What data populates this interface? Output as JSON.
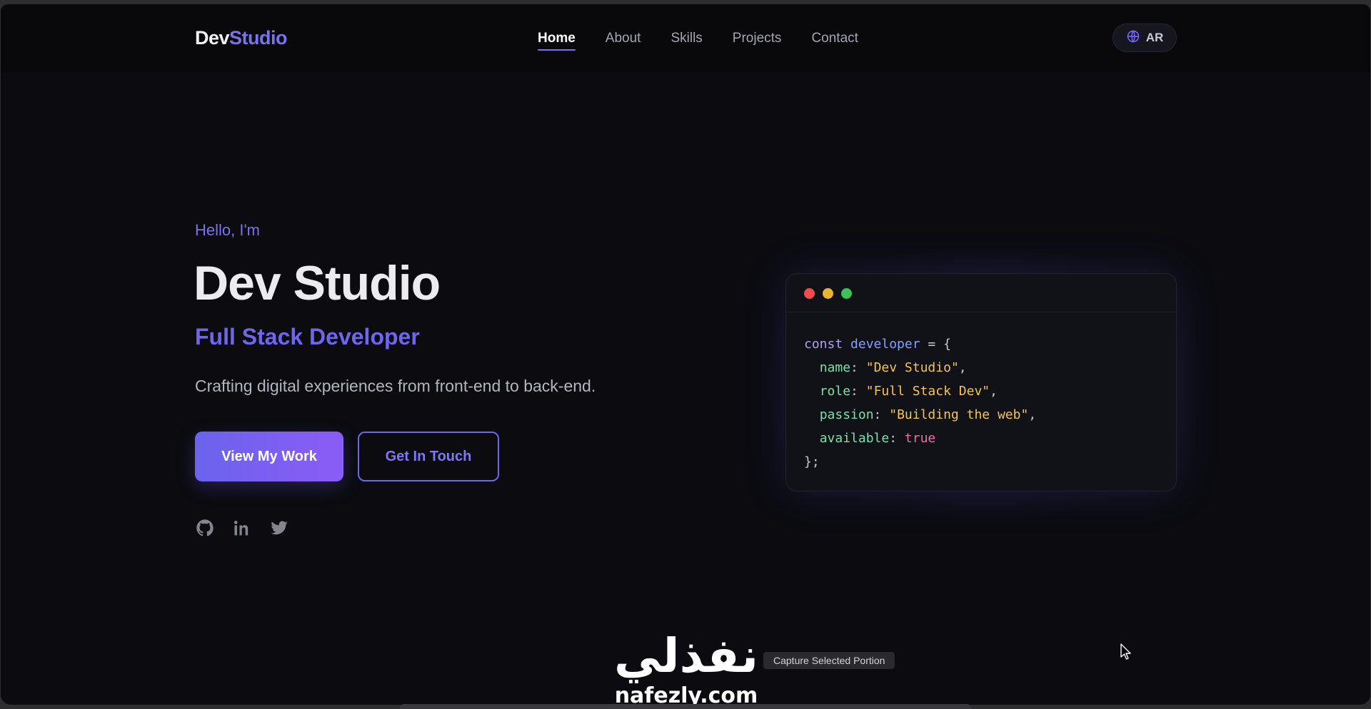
{
  "header": {
    "logo_part1": "Dev",
    "logo_part2": "Studio",
    "nav": [
      {
        "label": "Home",
        "active": true
      },
      {
        "label": "About"
      },
      {
        "label": "Skills"
      },
      {
        "label": "Projects"
      },
      {
        "label": "Contact"
      }
    ],
    "language_button": {
      "label": "AR",
      "icon": "globe-icon"
    }
  },
  "hero": {
    "greeting": "Hello, I'm",
    "name": "Dev Studio",
    "role": "Full Stack Developer",
    "tagline": "Crafting digital experiences from front-end to back-end.",
    "primary_button": "View My Work",
    "secondary_button": "Get In Touch",
    "social_icons": [
      "github-icon",
      "linkedin-icon",
      "twitter-icon"
    ]
  },
  "code_card": {
    "window_dots": [
      "red",
      "yellow",
      "green"
    ],
    "line1": {
      "keyword": "const",
      "var": "developer",
      "rest": " = {"
    },
    "line2": {
      "prop": "name",
      "value": "\"Dev Studio\""
    },
    "line3": {
      "prop": "role",
      "value": "\"Full Stack Dev\""
    },
    "line4": {
      "prop": "passion",
      "value": "\"Building the web\""
    },
    "line5": {
      "prop": "available",
      "value": "true"
    },
    "line6": "};"
  },
  "overlay": {
    "watermark_arabic": "نفذلي",
    "watermark_latin": "nafezly.com",
    "capture_tooltip": "Capture Selected Portion"
  },
  "colors": {
    "accent": "#7b72f0",
    "background": "#0b0b10",
    "button_gradient_start": "#6b63ee",
    "button_gradient_end": "#8b5cf6"
  }
}
